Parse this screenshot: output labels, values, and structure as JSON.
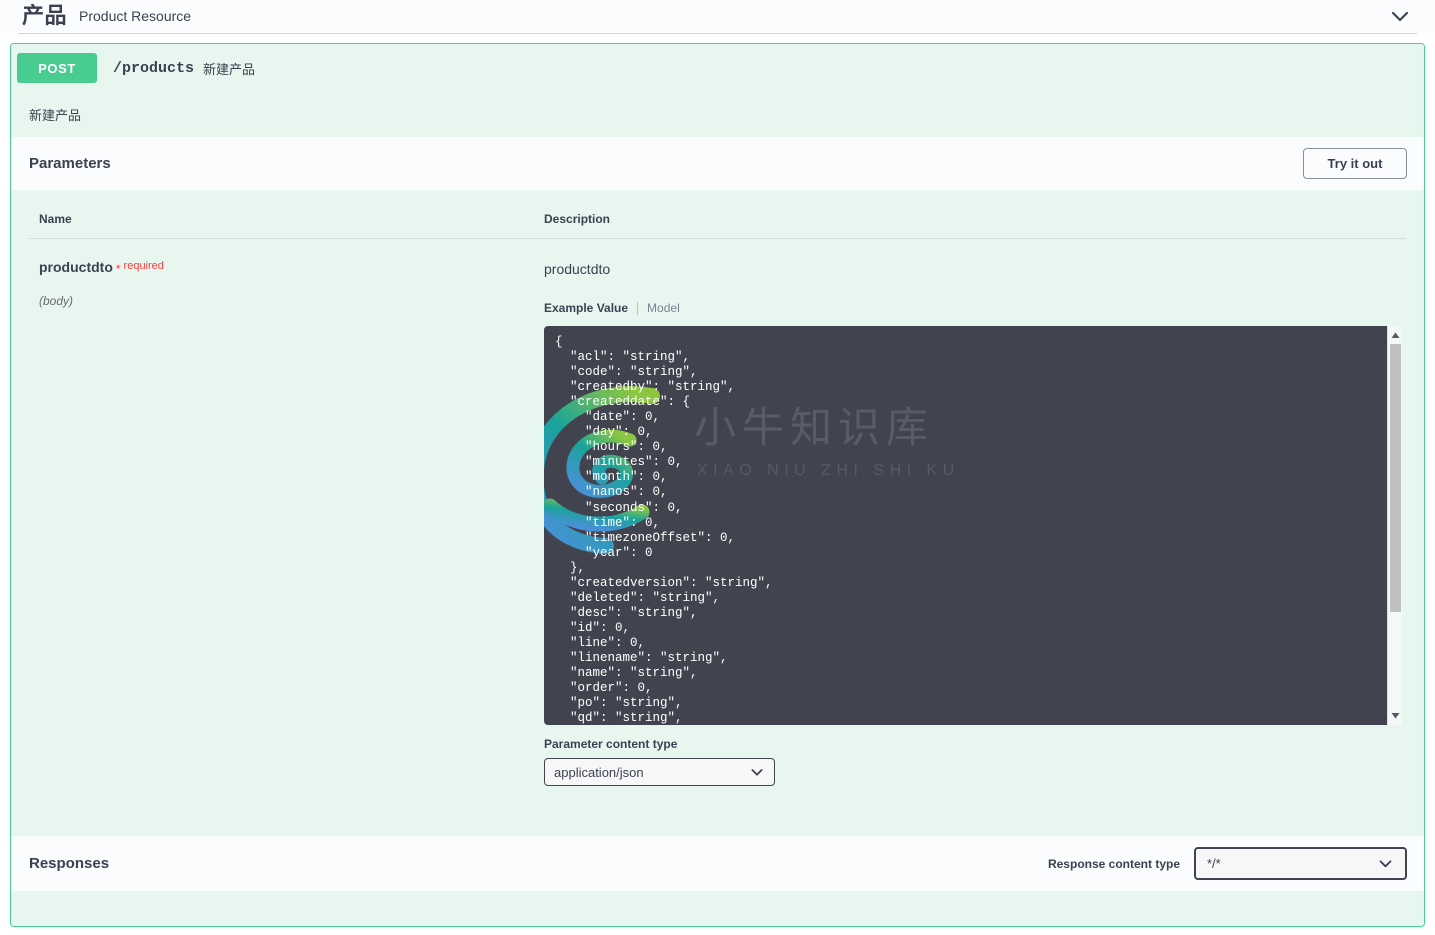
{
  "tag": {
    "title": "产品",
    "description": "Product Resource",
    "collapse_icon": "chevron-down-icon"
  },
  "operation": {
    "method": "POST",
    "path": "/products",
    "summary": "新建产品",
    "description": "新建产品",
    "method_color": "#49cc90",
    "block_bg": "#e8f6f0"
  },
  "parameters": {
    "section_title": "Parameters",
    "try_it_out_label": "Try it out",
    "headers": {
      "name": "Name",
      "description": "Description"
    },
    "row": {
      "name": "productdto",
      "required_star": "*",
      "required_label": "required",
      "location": "(body)",
      "description": "productdto",
      "tabs": {
        "example": "Example Value",
        "model": "Model"
      },
      "example_value": "{\n  \"acl\": \"string\",\n  \"code\": \"string\",\n  \"createdby\": \"string\",\n  \"createddate\": {\n    \"date\": 0,\n    \"day\": 0,\n    \"hours\": 0,\n    \"minutes\": 0,\n    \"month\": 0,\n    \"nanos\": 0,\n    \"seconds\": 0,\n    \"time\": 0,\n    \"timezoneOffset\": 0,\n    \"year\": 0\n  },\n  \"createdversion\": \"string\",\n  \"deleted\": \"string\",\n  \"desc\": \"string\",\n  \"id\": 0,\n  \"line\": 0,\n  \"linename\": \"string\",\n  \"name\": \"string\",\n  \"order\": 0,\n  \"po\": \"string\",\n  \"qd\": \"string\","
    },
    "content_type": {
      "label": "Parameter content type",
      "value": "application/json",
      "icon": "chevron-down-icon"
    }
  },
  "responses": {
    "section_title": "Responses",
    "content_type": {
      "label": "Response content type",
      "value": "*/*",
      "icon": "chevron-down-icon"
    }
  },
  "watermark": {
    "cn": "小牛知识库",
    "en": "XIAO NIU ZHI SHI KU"
  },
  "scrollbar": {
    "up_icon": "triangle-up-icon",
    "down_icon": "triangle-down-icon"
  }
}
